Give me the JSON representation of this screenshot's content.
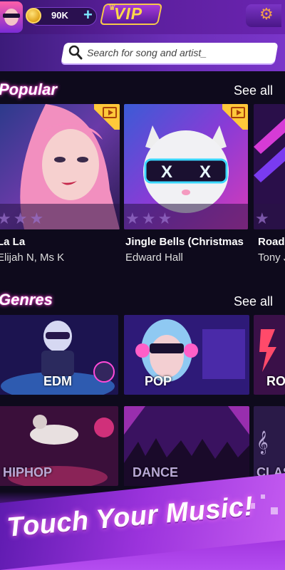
{
  "top_bar": {
    "coins": "90K",
    "add_symbol": "+",
    "vip_label": "VIP"
  },
  "search": {
    "placeholder": "Search for song and artist_"
  },
  "popular": {
    "title": "Popular",
    "see_all": "See all",
    "songs": [
      {
        "title": "La La",
        "artist": "Elijah N, Ms K",
        "has_video": false
      },
      {
        "title": "Jingle Bells (Christmas",
        "artist": "Edward Hall",
        "has_video": true
      },
      {
        "title": "Road",
        "artist": "Tony J",
        "has_video": false
      }
    ]
  },
  "genres": {
    "title": "Genres",
    "see_all": "See all",
    "items": [
      {
        "label": "EDM"
      },
      {
        "label": "POP"
      },
      {
        "label": "RO"
      },
      {
        "label": "HIPHOP"
      },
      {
        "label": "DANCE"
      },
      {
        "label": "CLAS"
      }
    ]
  },
  "banner": {
    "text": "Touch Your Music!"
  },
  "colors": {
    "accent": "#7a2bd6",
    "gold": "#ffd84a",
    "glow": "#ff4ad8"
  }
}
